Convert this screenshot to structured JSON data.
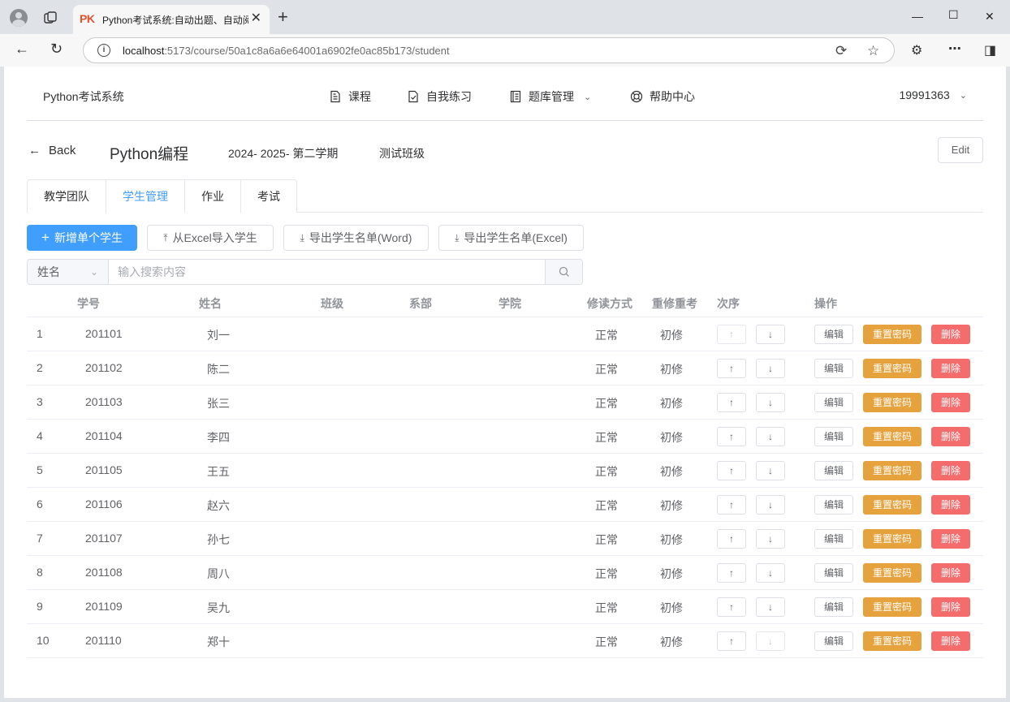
{
  "browser": {
    "tab_title": "Python考试系统:自动出题、自动阅",
    "tab_favicon_text": "PK",
    "url_host": "localhost",
    "url_rest": ":5173/course/50a1c8a6a6e64001a6902fe0ac85b173/student"
  },
  "header": {
    "brand": "Python考试系统",
    "menu": [
      {
        "label": "课程",
        "icon": "document-icon"
      },
      {
        "label": "自我练习",
        "icon": "checklist-icon"
      },
      {
        "label": "题库管理",
        "icon": "book-icon"
      },
      {
        "label": "帮助中心",
        "icon": "lifebuoy-icon"
      }
    ],
    "user": "19991363"
  },
  "course": {
    "back_label": "Back",
    "title": "Python编程",
    "term": "2024- 2025- 第二学期",
    "class_name": "测试班级",
    "edit_label": "Edit"
  },
  "tabs": [
    "教学团队",
    "学生管理",
    "作业",
    "考试"
  ],
  "active_tab": "学生管理",
  "actions": {
    "add": "新增单个学生",
    "import_excel": "从Excel导入学生",
    "export_word": "导出学生名单(Word)",
    "export_excel": "导出学生名单(Excel)"
  },
  "search": {
    "field_selected": "姓名",
    "placeholder": "输入搜索内容"
  },
  "table": {
    "columns": [
      "学号",
      "姓名",
      "班级",
      "系部",
      "学院",
      "修读方式",
      "重修重考",
      "次序",
      "操作"
    ],
    "row_buttons": {
      "edit": "编辑",
      "reset": "重置密码",
      "delete": "删除",
      "up": "↑",
      "down": "↓"
    },
    "rows": [
      {
        "index": "1",
        "id": "201101",
        "name": "刘一",
        "mode": "正常",
        "retake": "初修"
      },
      {
        "index": "2",
        "id": "201102",
        "name": "陈二",
        "mode": "正常",
        "retake": "初修"
      },
      {
        "index": "3",
        "id": "201103",
        "name": "张三",
        "mode": "正常",
        "retake": "初修"
      },
      {
        "index": "4",
        "id": "201104",
        "name": "李四",
        "mode": "正常",
        "retake": "初修"
      },
      {
        "index": "5",
        "id": "201105",
        "name": "王五",
        "mode": "正常",
        "retake": "初修"
      },
      {
        "index": "6",
        "id": "201106",
        "name": "赵六",
        "mode": "正常",
        "retake": "初修"
      },
      {
        "index": "7",
        "id": "201107",
        "name": "孙七",
        "mode": "正常",
        "retake": "初修"
      },
      {
        "index": "8",
        "id": "201108",
        "name": "周八",
        "mode": "正常",
        "retake": "初修"
      },
      {
        "index": "9",
        "id": "201109",
        "name": "吴九",
        "mode": "正常",
        "retake": "初修"
      },
      {
        "index": "10",
        "id": "201110",
        "name": "郑十",
        "mode": "正常",
        "retake": "初修"
      }
    ]
  },
  "colors": {
    "primary": "#409eff",
    "warning": "#e6a23c",
    "danger": "#f56c6c"
  }
}
